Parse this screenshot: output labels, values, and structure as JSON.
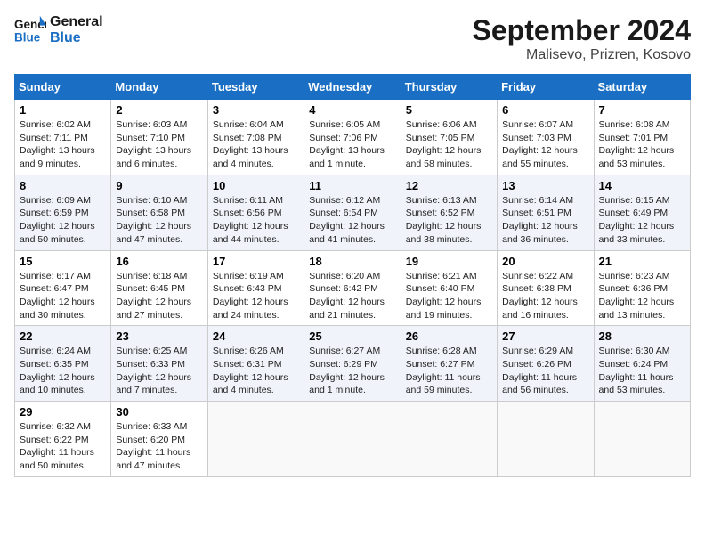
{
  "header": {
    "logo_line1": "General",
    "logo_line2": "Blue",
    "month_year": "September 2024",
    "location": "Malisevo, Prizren, Kosovo"
  },
  "weekdays": [
    "Sunday",
    "Monday",
    "Tuesday",
    "Wednesday",
    "Thursday",
    "Friday",
    "Saturday"
  ],
  "weeks": [
    [
      {
        "day": "1",
        "info": "Sunrise: 6:02 AM\nSunset: 7:11 PM\nDaylight: 13 hours\nand 9 minutes."
      },
      {
        "day": "2",
        "info": "Sunrise: 6:03 AM\nSunset: 7:10 PM\nDaylight: 13 hours\nand 6 minutes."
      },
      {
        "day": "3",
        "info": "Sunrise: 6:04 AM\nSunset: 7:08 PM\nDaylight: 13 hours\nand 4 minutes."
      },
      {
        "day": "4",
        "info": "Sunrise: 6:05 AM\nSunset: 7:06 PM\nDaylight: 13 hours\nand 1 minute."
      },
      {
        "day": "5",
        "info": "Sunrise: 6:06 AM\nSunset: 7:05 PM\nDaylight: 12 hours\nand 58 minutes."
      },
      {
        "day": "6",
        "info": "Sunrise: 6:07 AM\nSunset: 7:03 PM\nDaylight: 12 hours\nand 55 minutes."
      },
      {
        "day": "7",
        "info": "Sunrise: 6:08 AM\nSunset: 7:01 PM\nDaylight: 12 hours\nand 53 minutes."
      }
    ],
    [
      {
        "day": "8",
        "info": "Sunrise: 6:09 AM\nSunset: 6:59 PM\nDaylight: 12 hours\nand 50 minutes."
      },
      {
        "day": "9",
        "info": "Sunrise: 6:10 AM\nSunset: 6:58 PM\nDaylight: 12 hours\nand 47 minutes."
      },
      {
        "day": "10",
        "info": "Sunrise: 6:11 AM\nSunset: 6:56 PM\nDaylight: 12 hours\nand 44 minutes."
      },
      {
        "day": "11",
        "info": "Sunrise: 6:12 AM\nSunset: 6:54 PM\nDaylight: 12 hours\nand 41 minutes."
      },
      {
        "day": "12",
        "info": "Sunrise: 6:13 AM\nSunset: 6:52 PM\nDaylight: 12 hours\nand 38 minutes."
      },
      {
        "day": "13",
        "info": "Sunrise: 6:14 AM\nSunset: 6:51 PM\nDaylight: 12 hours\nand 36 minutes."
      },
      {
        "day": "14",
        "info": "Sunrise: 6:15 AM\nSunset: 6:49 PM\nDaylight: 12 hours\nand 33 minutes."
      }
    ],
    [
      {
        "day": "15",
        "info": "Sunrise: 6:17 AM\nSunset: 6:47 PM\nDaylight: 12 hours\nand 30 minutes."
      },
      {
        "day": "16",
        "info": "Sunrise: 6:18 AM\nSunset: 6:45 PM\nDaylight: 12 hours\nand 27 minutes."
      },
      {
        "day": "17",
        "info": "Sunrise: 6:19 AM\nSunset: 6:43 PM\nDaylight: 12 hours\nand 24 minutes."
      },
      {
        "day": "18",
        "info": "Sunrise: 6:20 AM\nSunset: 6:42 PM\nDaylight: 12 hours\nand 21 minutes."
      },
      {
        "day": "19",
        "info": "Sunrise: 6:21 AM\nSunset: 6:40 PM\nDaylight: 12 hours\nand 19 minutes."
      },
      {
        "day": "20",
        "info": "Sunrise: 6:22 AM\nSunset: 6:38 PM\nDaylight: 12 hours\nand 16 minutes."
      },
      {
        "day": "21",
        "info": "Sunrise: 6:23 AM\nSunset: 6:36 PM\nDaylight: 12 hours\nand 13 minutes."
      }
    ],
    [
      {
        "day": "22",
        "info": "Sunrise: 6:24 AM\nSunset: 6:35 PM\nDaylight: 12 hours\nand 10 minutes."
      },
      {
        "day": "23",
        "info": "Sunrise: 6:25 AM\nSunset: 6:33 PM\nDaylight: 12 hours\nand 7 minutes."
      },
      {
        "day": "24",
        "info": "Sunrise: 6:26 AM\nSunset: 6:31 PM\nDaylight: 12 hours\nand 4 minutes."
      },
      {
        "day": "25",
        "info": "Sunrise: 6:27 AM\nSunset: 6:29 PM\nDaylight: 12 hours\nand 1 minute."
      },
      {
        "day": "26",
        "info": "Sunrise: 6:28 AM\nSunset: 6:27 PM\nDaylight: 11 hours\nand 59 minutes."
      },
      {
        "day": "27",
        "info": "Sunrise: 6:29 AM\nSunset: 6:26 PM\nDaylight: 11 hours\nand 56 minutes."
      },
      {
        "day": "28",
        "info": "Sunrise: 6:30 AM\nSunset: 6:24 PM\nDaylight: 11 hours\nand 53 minutes."
      }
    ],
    [
      {
        "day": "29",
        "info": "Sunrise: 6:32 AM\nSunset: 6:22 PM\nDaylight: 11 hours\nand 50 minutes."
      },
      {
        "day": "30",
        "info": "Sunrise: 6:33 AM\nSunset: 6:20 PM\nDaylight: 11 hours\nand 47 minutes."
      },
      null,
      null,
      null,
      null,
      null
    ]
  ]
}
